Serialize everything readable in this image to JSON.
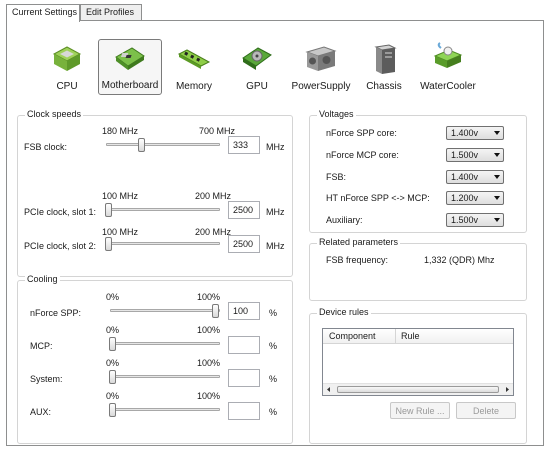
{
  "tabs": [
    {
      "label": "Current Settings",
      "active": true
    },
    {
      "label": "Edit Profiles",
      "active": false
    }
  ],
  "categories": [
    {
      "label": "CPU",
      "icon": "cpu-icon"
    },
    {
      "label": "Motherboard",
      "icon": "motherboard-icon",
      "selected": true
    },
    {
      "label": "Memory",
      "icon": "memory-icon"
    },
    {
      "label": "GPU",
      "icon": "gpu-icon"
    },
    {
      "label": "PowerSupply",
      "icon": "power-supply-icon"
    },
    {
      "label": "Chassis",
      "icon": "chassis-icon"
    },
    {
      "label": "WaterCooler",
      "icon": "water-cooler-icon"
    }
  ],
  "clock": {
    "title": "Clock speeds",
    "fsb": {
      "label": "FSB clock:",
      "min": "180 MHz",
      "max": "700 MHz",
      "value": "333",
      "unit": "MHz"
    },
    "pcie1": {
      "label": "PCIe clock, slot 1:",
      "min": "100 MHz",
      "max": "200 MHz",
      "value": "2500",
      "unit": "MHz"
    },
    "pcie2": {
      "label": "PCIe clock, slot 2:",
      "min": "100 MHz",
      "max": "200 MHz",
      "value": "2500",
      "unit": "MHz"
    }
  },
  "cooling": {
    "title": "Cooling",
    "rows": [
      {
        "label": "nForce SPP:",
        "min": "0%",
        "max": "100%",
        "value": "100",
        "unit": "%"
      },
      {
        "label": "MCP:",
        "min": "0%",
        "max": "100%",
        "value": "",
        "unit": "%"
      },
      {
        "label": "System:",
        "min": "0%",
        "max": "100%",
        "value": "",
        "unit": "%"
      },
      {
        "label": "AUX:",
        "min": "0%",
        "max": "100%",
        "value": "",
        "unit": "%"
      }
    ]
  },
  "voltages": {
    "title": "Voltages",
    "rows": [
      {
        "label": "nForce SPP core:",
        "value": "1.400v"
      },
      {
        "label": "nForce MCP core:",
        "value": "1.500v"
      },
      {
        "label": "FSB:",
        "value": "1.400v"
      },
      {
        "label": "HT nForce SPP <-> MCP:",
        "value": "1.200v"
      },
      {
        "label": "Auxiliary:",
        "value": "1.500v"
      }
    ]
  },
  "related": {
    "title": "Related parameters",
    "label": "FSB frequency:",
    "value": "1,332 (QDR) Mhz"
  },
  "device_rules": {
    "title": "Device rules",
    "columns": [
      "Component",
      "Rule"
    ],
    "new_rule": "New Rule ...",
    "delete": "Delete"
  }
}
